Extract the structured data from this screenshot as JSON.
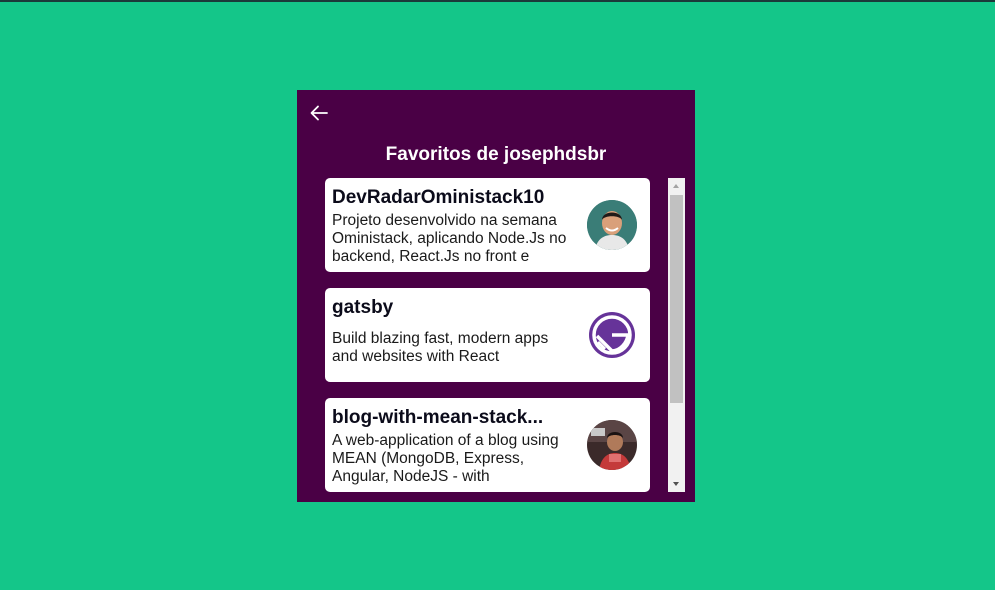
{
  "header": {
    "title": "Favoritos de josephdsbr",
    "back_icon": "arrow-left-icon"
  },
  "colors": {
    "page_background": "#14c689",
    "panel_background": "#4a0045",
    "card_background": "#ffffff",
    "title_text": "#ffffff"
  },
  "repos": [
    {
      "name": "DevRadarOministack10",
      "description": "Projeto desenvolvido na semana Oministack, aplicando Node.Js no backend, React.Js no front e",
      "avatar": "user-avatar"
    },
    {
      "name": "gatsby",
      "description": "Build blazing fast, modern apps and websites with React",
      "avatar": "gatsby-logo"
    },
    {
      "name": "blog-with-mean-stack...",
      "description": "A web-application of a blog using MEAN (MongoDB, Express, Angular, NodeJS - with",
      "avatar": "user-avatar"
    }
  ],
  "scrollbar": {
    "scroll_position": 0
  }
}
